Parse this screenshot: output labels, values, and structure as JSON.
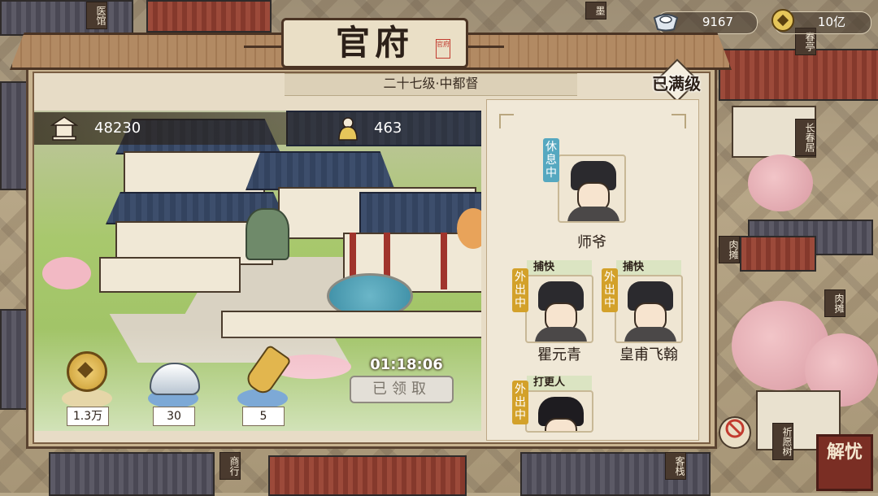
{
  "background": {
    "signs": [
      "医馆",
      "墨",
      "春亭",
      "长春居",
      "肉摊",
      "肉摊",
      "祈愿树",
      "客栈",
      "商行"
    ]
  },
  "resources": {
    "silver": {
      "icon": "silver-ingot-icon",
      "value": "9167"
    },
    "copper": {
      "icon": "copper-coin-icon",
      "value": "10亿"
    }
  },
  "panel": {
    "title": "官府",
    "seal": "官府",
    "level_text": "二十七级·中都督",
    "max_badge": "已满级"
  },
  "scene": {
    "prosperity": {
      "icon": "pavilion-icon",
      "value": "48230"
    },
    "population": {
      "icon": "gourd-icon",
      "value": "463"
    },
    "rewards": [
      {
        "icon": "copper-coin-icon",
        "amount": "1.3万"
      },
      {
        "icon": "silver-ingot-icon",
        "amount": "30"
      },
      {
        "icon": "token-plaque-icon",
        "amount": "5"
      }
    ],
    "timer": "01:18:06",
    "claim_button": "已领取"
  },
  "staff": [
    {
      "name": "师爷",
      "status": "休息中",
      "role": ""
    },
    {
      "name": "瞿元青",
      "status": "外出中",
      "role": "捕快"
    },
    {
      "name": "皇甫飞翰",
      "status": "外出中",
      "role": "捕快"
    },
    {
      "name": "",
      "status": "外出中",
      "role": "打更人"
    }
  ],
  "corner_logo": "解忧",
  "colors": {
    "accent_brown": "#5a4330",
    "status_rest": "#56a8c0",
    "status_out": "#d3a12a"
  }
}
